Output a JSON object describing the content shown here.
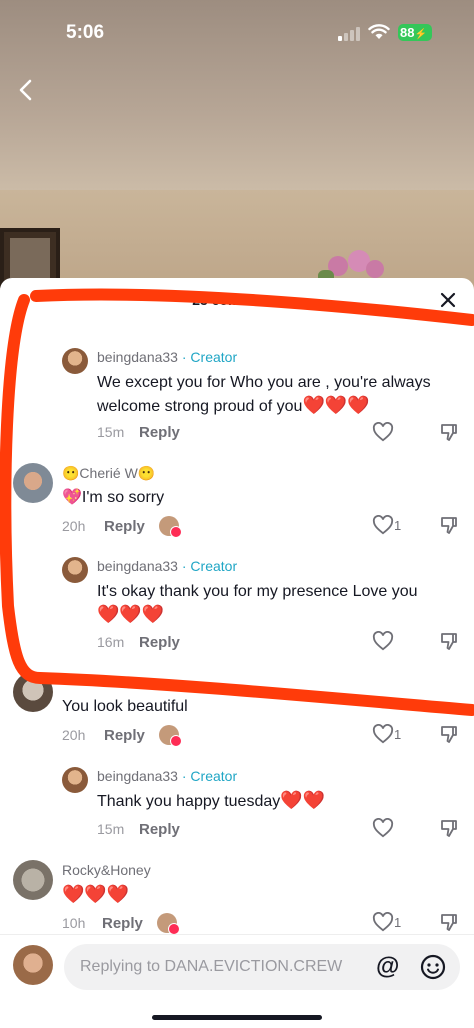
{
  "status_bar": {
    "time": "5:06",
    "battery": "88"
  },
  "sheet": {
    "title": "23 comments"
  },
  "comments": [
    {
      "username": "beingdana33",
      "badge": "· Creator",
      "text": "We except you for Who you are , you're always welcome strong proud of you",
      "hearts": "❤️❤️❤️",
      "time": "15m",
      "reply_label": "Reply"
    },
    {
      "username": "😶Cherié W😶",
      "emoji_prefix": "💖",
      "text": "I'm so sorry",
      "time": "20h",
      "reply_label": "Reply",
      "likes": "1"
    },
    {
      "username": "beingdana33",
      "badge": "· Creator",
      "text": "It's okay thank you for my presence Love you",
      "hearts": "❤️❤️❤️",
      "time": "16m",
      "reply_label": "Reply"
    },
    {
      "text": "You look beautiful",
      "time": "20h",
      "reply_label": "Reply",
      "likes": "1"
    },
    {
      "username": "beingdana33",
      "badge": "· Creator",
      "text": "Thank you happy tuesday",
      "hearts": "❤️❤️",
      "time": "15m",
      "reply_label": "Reply"
    },
    {
      "username": "Rocky&Honey",
      "hearts": "❤️❤️❤️",
      "time": "10h",
      "reply_label": "Reply",
      "likes": "1"
    }
  ],
  "input": {
    "placeholder": "Replying to DANA.EVICTION.CREW"
  },
  "icons": {
    "back": "chevron-left-icon",
    "close": "close-icon",
    "like": "heart-outline-icon",
    "dislike": "thumbs-down-icon",
    "mention": "at-icon",
    "emoji": "smile-icon"
  },
  "colors": {
    "creator": "#20a6c5",
    "annotation": "#ff3b0a",
    "battery": "#34c759"
  }
}
